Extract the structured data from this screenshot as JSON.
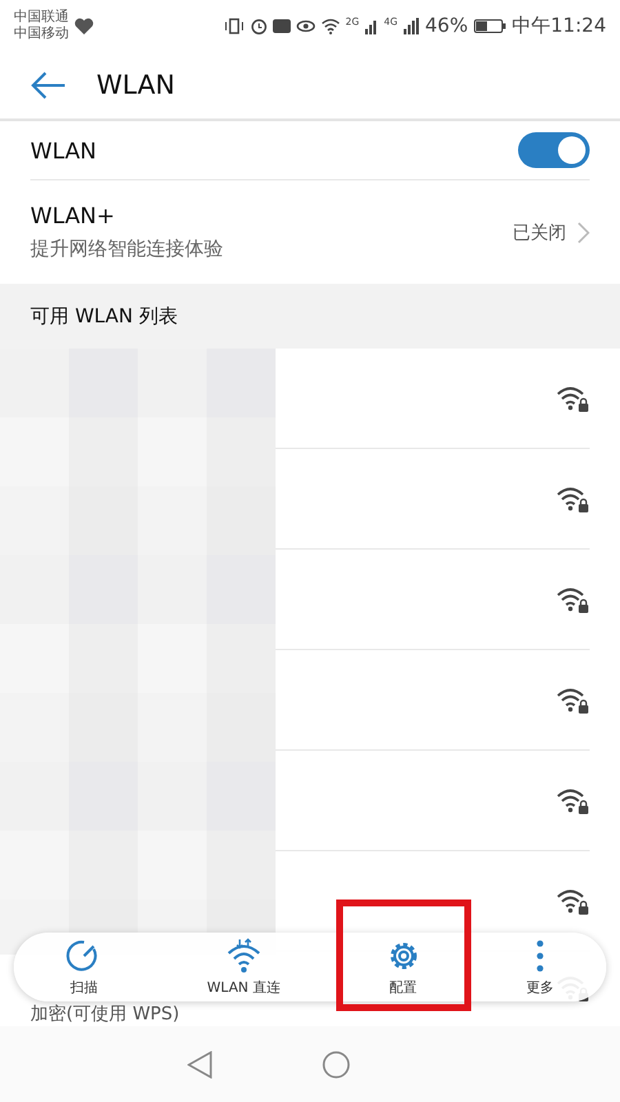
{
  "status_bar": {
    "carriers": [
      "中国联通",
      "中国移动"
    ],
    "network_2g": "2G",
    "network_4g": "4G",
    "battery": "46%",
    "time": "中午11:24"
  },
  "app_bar": {
    "title": "WLAN"
  },
  "wlan_switch": {
    "label": "WLAN",
    "on": true
  },
  "wlan_plus": {
    "title": "WLAN+",
    "subtitle": "提升网络智能连接体验",
    "status": "已关闭"
  },
  "section_header": "可用 WLAN 列表",
  "networks": [
    {
      "secured": true
    },
    {
      "secured": true
    },
    {
      "secured": true
    },
    {
      "secured": true
    },
    {
      "secured": true
    },
    {
      "secured": true
    },
    {
      "secured": true,
      "subtitle": "加密(可使用 WPS)"
    }
  ],
  "toolbar": [
    {
      "kind": "scan",
      "label": "扫描",
      "highlighted": false
    },
    {
      "kind": "direct",
      "label": "WLAN 直连",
      "highlighted": false
    },
    {
      "kind": "settings",
      "label": "配置",
      "highlighted": true
    },
    {
      "kind": "more",
      "label": "更多",
      "highlighted": false
    }
  ]
}
